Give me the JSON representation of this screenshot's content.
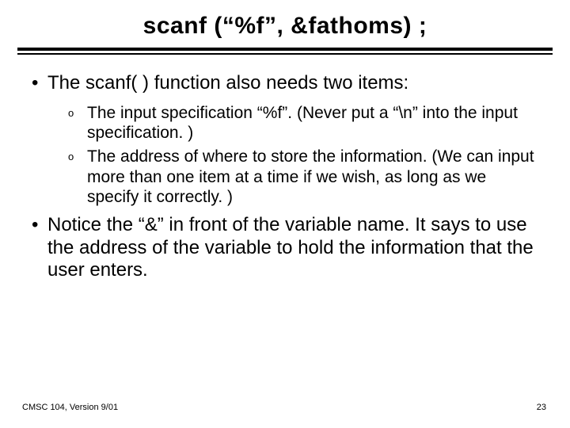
{
  "title": "scanf (“%f”, &fathoms) ;",
  "bullets": {
    "first": "The scanf( ) function also needs two items:",
    "sub1": "The input specification “%f”.  (Never put a “\\n” into the input specification. )",
    "sub2": "The address of where to store the information. (We can input more than one item at a time if we wish, as long as we specify it correctly. )",
    "second": "Notice the “&” in front of the variable name. It says to use the address of the variable to hold the information that the user enters."
  },
  "markers": {
    "dot": "•",
    "circle": "o"
  },
  "footer": {
    "left": "CMSC 104, Version 9/01",
    "right": "23"
  }
}
